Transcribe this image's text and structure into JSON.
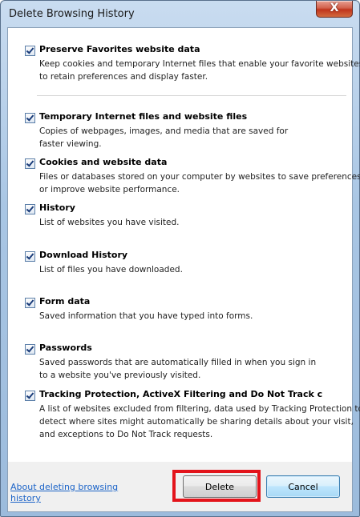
{
  "window": {
    "title": "Delete Browsing History",
    "close_label": "X"
  },
  "options": [
    {
      "title": "Preserve Favorites website data",
      "desc": "Keep cookies and temporary Internet files that enable your favorite websites to retain preferences and display faster.",
      "checked": true
    },
    {
      "title": "Temporary Internet files and website files",
      "desc": "Copies of webpages, images, and media that are saved for faster viewing.",
      "checked": true
    },
    {
      "title": "Cookies and website data",
      "desc": "Files or databases stored on your computer by websites to save preferences or improve website performance.",
      "checked": true
    },
    {
      "title": "History",
      "desc": "List of websites you have visited.",
      "checked": true
    },
    {
      "title": "Download History",
      "desc": "List of files you have downloaded.",
      "checked": true
    },
    {
      "title": "Form data",
      "desc": "Saved information that you have typed into forms.",
      "checked": true
    },
    {
      "title": "Passwords",
      "desc": "Saved passwords that are automatically filled in when you sign in to a website you've previously visited.",
      "checked": true
    },
    {
      "title": "Tracking Protection, ActiveX Filtering and Do Not Track c",
      "desc": "A list of websites excluded from filtering, data used by Tracking Protection to detect where sites might automatically be sharing details about your visit, and exceptions to Do Not Track requests.",
      "checked": true
    }
  ],
  "footer": {
    "link": "About deleting browsing history",
    "delete_label": "Delete",
    "cancel_label": "Cancel"
  },
  "colors": {
    "highlight": "#e3141b",
    "link": "#1c64c8"
  }
}
